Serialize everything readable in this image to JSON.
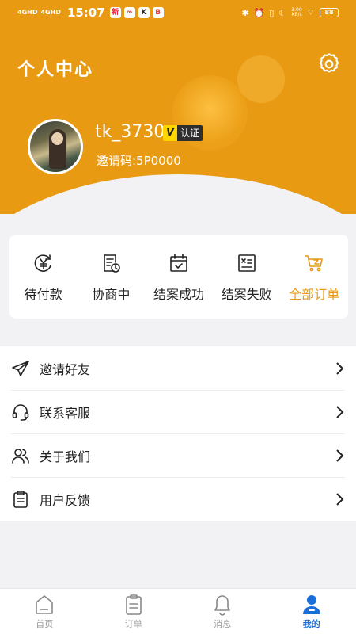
{
  "statusbar": {
    "signal1": "4GHD",
    "signal2": "4GHD",
    "time": "15:07",
    "app_icons": [
      "新",
      "∞",
      "K",
      "B"
    ],
    "net_speed": "3.00",
    "net_unit": "KB/s",
    "battery": "88"
  },
  "header": {
    "title": "个人中心"
  },
  "profile": {
    "username": "tk_3730",
    "verify_mark": "V",
    "verify_text": "认证",
    "invite_code": "邀请码:5P0000"
  },
  "orders": {
    "items": [
      {
        "label": "待付款",
        "icon": "yen-refresh-icon"
      },
      {
        "label": "协商中",
        "icon": "document-clock-icon"
      },
      {
        "label": "结案成功",
        "icon": "calendar-check-icon"
      },
      {
        "label": "结案失败",
        "icon": "document-x-icon"
      },
      {
        "label": "全部订单",
        "icon": "cart-icon",
        "active": true
      }
    ]
  },
  "menu": {
    "items": [
      {
        "label": "邀请好友",
        "icon": "paper-plane-icon"
      },
      {
        "label": "联系客服",
        "icon": "headset-icon"
      },
      {
        "label": "关于我们",
        "icon": "users-icon"
      },
      {
        "label": "用户反馈",
        "icon": "clipboard-icon"
      }
    ]
  },
  "tabbar": {
    "items": [
      {
        "label": "首页",
        "icon": "home-icon"
      },
      {
        "label": "订单",
        "icon": "order-list-icon"
      },
      {
        "label": "消息",
        "icon": "bell-icon"
      },
      {
        "label": "我的",
        "icon": "user-icon",
        "active": true
      }
    ]
  },
  "colors": {
    "brand": "#e89a12",
    "active_tab": "#1a6ed8",
    "background": "#f2f2f4"
  }
}
